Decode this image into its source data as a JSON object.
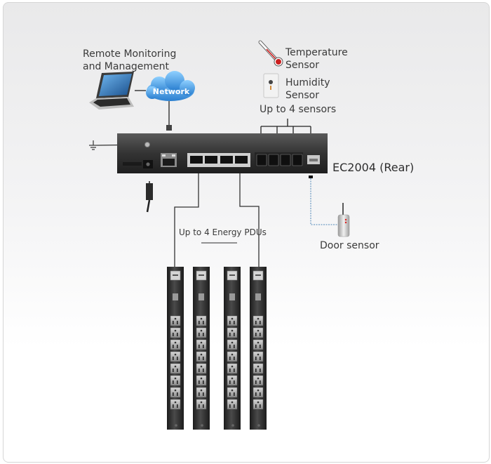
{
  "diagram": {
    "remote": {
      "label_line1": "Remote Monitoring",
      "label_line2": "and Management",
      "network_label": "Network"
    },
    "sensors": {
      "temperature_line1": "Temperature",
      "temperature_line2": "Sensor",
      "humidity_line1": "Humidity",
      "humidity_line2": "Sensor",
      "count_label": "Up to 4 sensors"
    },
    "device": {
      "model_label": "EC2004 (Rear)",
      "lan_ports": 1,
      "pdu_ports": 4,
      "sensor_ports": 4
    },
    "door_sensor": {
      "label": "Door sensor"
    },
    "pdus": {
      "label": "Up to 4 Energy PDUs",
      "count": 4,
      "outlets_per_pdu": 8
    },
    "colors": {
      "network_cloud": "#3a8fd6",
      "device_body": "#3b3b3b",
      "pdu_body": "#2f2f2f",
      "door_line": "#4f87b8",
      "thermometer_red": "#cc1f1f"
    }
  }
}
